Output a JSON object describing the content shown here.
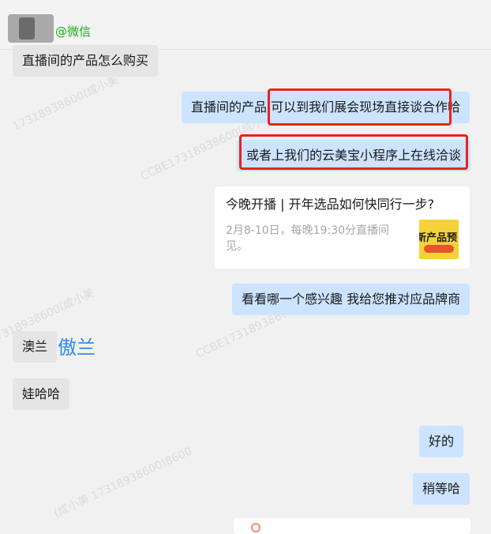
{
  "header": {
    "source": "@微信"
  },
  "messages": {
    "m1": "直播间的产品怎么购买",
    "m2": "直播间的产品 可以到我们展会现场直接谈合作哈",
    "m3": "或者上我们的云美宝小程序上在线洽谈",
    "m5": "看看哪一个感兴趣 我给您推对应品牌商",
    "m6": "澳兰",
    "m7": "娃哈哈",
    "m8": "好的",
    "m9": "稍等哈"
  },
  "card": {
    "title": "今晚开播 | 开年选品如何快同行一步?",
    "desc": "2月8-10日，每晚19:30分直播间见。",
    "thumb_text": "新产品预"
  },
  "annotation": {
    "handwritten": "傲兰"
  },
  "watermark": {
    "text1": "CCBE17318938600(成小美",
    "text2": "17318938600(成小美",
    "text3": "(成小美 17318938600)8600",
    "text4": "CCBE17318938600(成小美"
  },
  "colors": {
    "highlight_box": "#e8231b",
    "outgoing_bubble": "#cce4ff",
    "incoming_bubble": "#e5e5e5",
    "annotation": "#2d8cf0"
  }
}
